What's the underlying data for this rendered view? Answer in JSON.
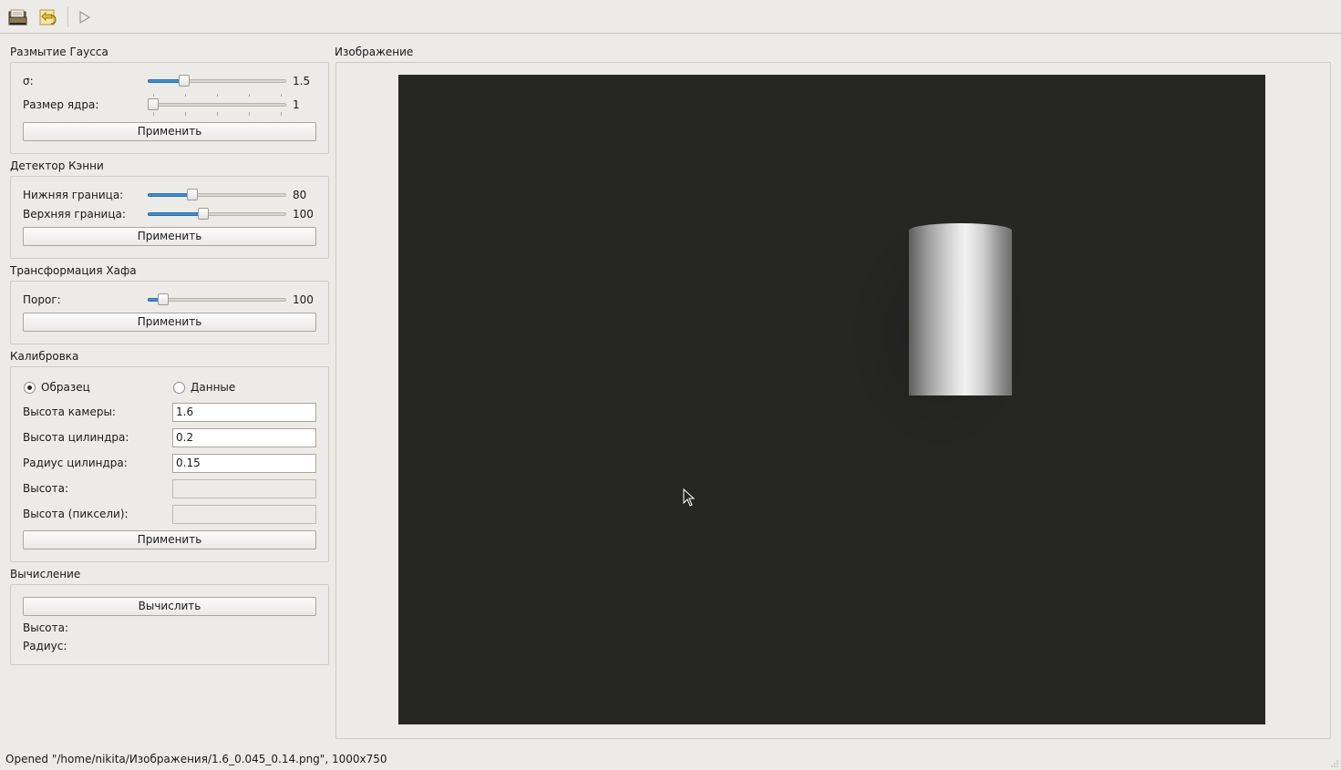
{
  "toolbar": {
    "open_icon": "folder-open-icon",
    "reload_icon": "reload-icon",
    "run_icon": "play-icon"
  },
  "gauss": {
    "title": "Размытие Гаусса",
    "sigma_label": "σ:",
    "sigma_value": "1.5",
    "sigma_fraction": 0.24,
    "kernel_label": "Размер ядра:",
    "kernel_value": "1",
    "kernel_fraction": 0.0,
    "apply_label": "Применить"
  },
  "canny": {
    "title": "Детектор Кэнни",
    "lower_label": "Нижняя граница:",
    "lower_value": "80",
    "lower_fraction": 0.31,
    "upper_label": "Верхняя граница:",
    "upper_value": "100",
    "upper_fraction": 0.39,
    "apply_label": "Применить"
  },
  "hough": {
    "title": "Трансформация Хафа",
    "threshold_label": "Порог:",
    "threshold_value": "100",
    "threshold_fraction": 0.08,
    "apply_label": "Применить"
  },
  "calibration": {
    "title": "Калибровка",
    "radio_sample": "Образец",
    "radio_data": "Данные",
    "selected": "Образец",
    "camera_height_label": "Высота камеры:",
    "camera_height_value": "1.6",
    "cylinder_height_label": "Высота цилиндра:",
    "cylinder_height_value": "0.2",
    "cylinder_radius_label": "Радиус цилиндра:",
    "cylinder_radius_value": "0.15",
    "height_label": "Высота:",
    "height_value": "",
    "height_px_label": "Высота (пиксели):",
    "height_px_value": "",
    "apply_label": "Применить"
  },
  "compute": {
    "title": "Вычисление",
    "compute_label": "Вычислить",
    "height_label": "Высота:",
    "radius_label": "Радиус:"
  },
  "image_panel": {
    "title": "Изображение"
  },
  "status": {
    "text": "Opened \"/home/nikita/Изображения/1.6_0.045_0.14.png\", 1000x750"
  },
  "colors": {
    "accent": "#3d8fd1",
    "image_bg": "#262725",
    "window_bg": "#edebe8"
  }
}
